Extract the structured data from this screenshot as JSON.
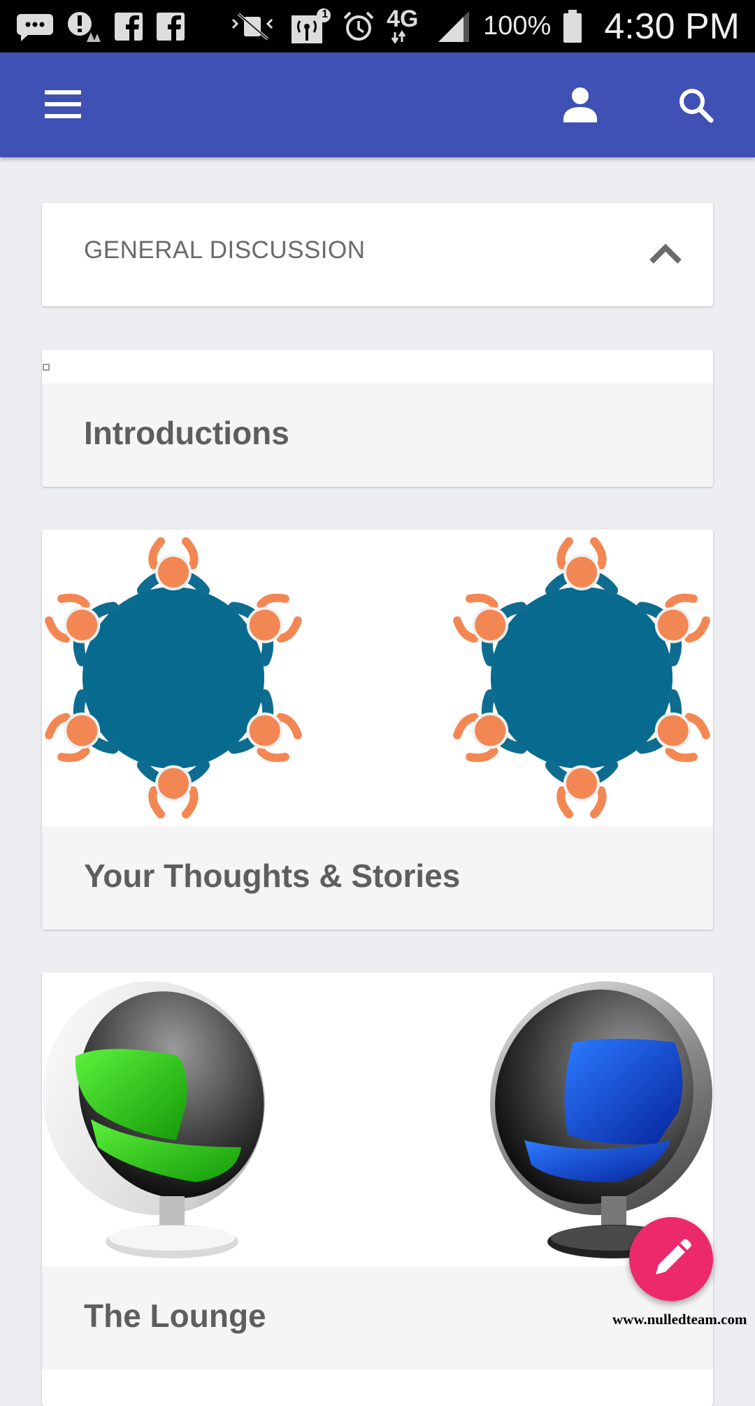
{
  "status_bar": {
    "icons": [
      "messages-icon",
      "alert-icon",
      "facebook-icon",
      "facebook-icon",
      "mute-icon",
      "hotspot-icon",
      "alarm-icon",
      "network-4g-lte-icon",
      "signal-icon",
      "battery-icon"
    ],
    "hotspot_badge": "1",
    "network_label": "4G",
    "battery_level": "100%",
    "time": "4:30 PM"
  },
  "app_bar": {
    "menu_icon": "hamburger-menu-icon",
    "profile_icon": "person-icon",
    "search_icon": "search-icon",
    "color": "#3f51b5"
  },
  "section": {
    "title": "GENERAL DISCUSSION",
    "toggle_icon": "chevron-up-icon"
  },
  "forums": [
    {
      "title": "Introductions",
      "image": "broken-image-icon"
    },
    {
      "title": "Your Thoughts & Stories",
      "image": "round-table-meeting-illustration"
    },
    {
      "title": "The Lounge",
      "image": "egg-chair-illustration"
    }
  ],
  "fab": {
    "icon": "pencil-icon",
    "color": "#ec2a6b"
  },
  "watermark": "www.nulledteam.com"
}
